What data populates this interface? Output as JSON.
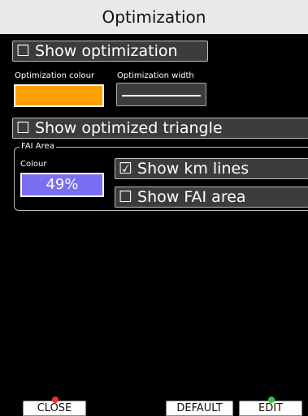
{
  "window": {
    "title": "Optimization"
  },
  "optimization": {
    "show_optimization": {
      "checked": false,
      "label": "Show optimization"
    },
    "colour_label": "Optimization colour",
    "width_label": "Optimization width",
    "colour": "#ffa200",
    "show_optimized_triangle": {
      "checked": false,
      "label": "Show optimized triangle"
    }
  },
  "fai_area": {
    "group_title": "FAI Area",
    "colour_label": "Colour",
    "colour_value": "49%",
    "colour": "#7a6ff2",
    "show_km_lines": {
      "checked": true,
      "label": "Show km lines"
    },
    "show_fai_area": {
      "checked": false,
      "label": "Show FAI area"
    }
  },
  "toolbar": {
    "close_label": "CLOSE",
    "default_label": "DEFAULT",
    "edit_label": "EDIT",
    "close_marker_color": "#e8333b",
    "edit_marker_color": "#3fbf4d"
  },
  "glyphs": {
    "unchecked": "☐",
    "checked": "☑"
  }
}
